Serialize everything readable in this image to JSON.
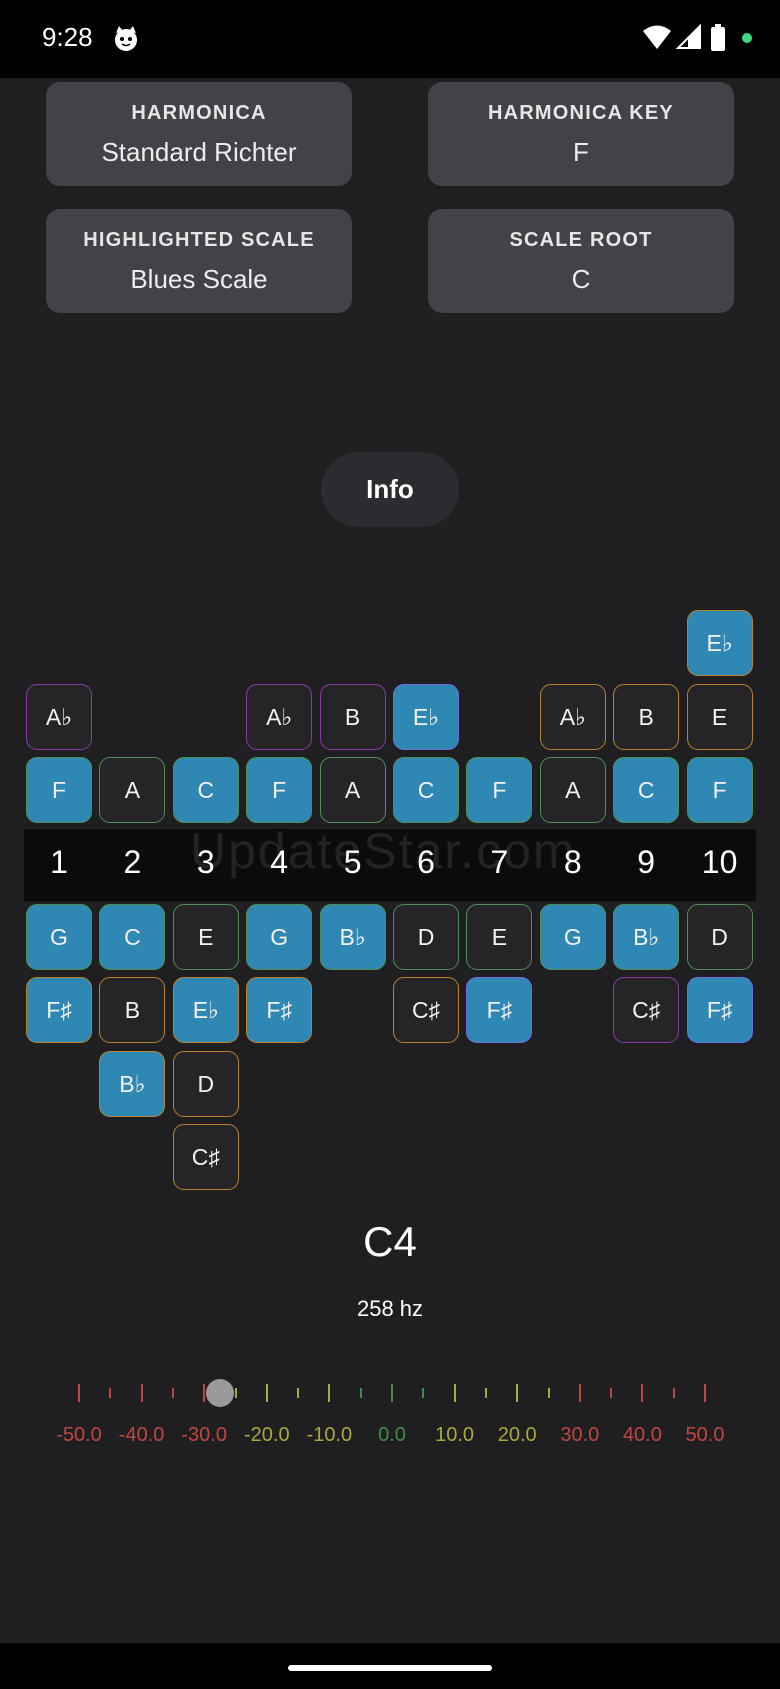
{
  "status": {
    "time": "9:28"
  },
  "cards": {
    "harmonica": {
      "label": "HARMONICA",
      "value": "Standard Richter"
    },
    "harmonica_key": {
      "label": "HARMONICA KEY",
      "value": "F"
    },
    "highlighted_scale": {
      "label": "HIGHLIGHTED SCALE",
      "value": "Blues Scale"
    },
    "scale_root": {
      "label": "SCALE ROOT",
      "value": "C"
    }
  },
  "info_button": "Info",
  "colors": {
    "highlight": "#2e88b3",
    "green_border": "#4f8f55",
    "purple_border": "#8a3aa8",
    "orange_border": "#b7822a",
    "blue_border": "#6f6fe0",
    "red_tick": "#c0463f",
    "yellow_tick": "#a9a83a",
    "green_tick": "#3e8f45"
  },
  "holes": [
    "1",
    "2",
    "3",
    "4",
    "5",
    "6",
    "7",
    "8",
    "9",
    "10"
  ],
  "note_grid": [
    {
      "note": "E♭",
      "hole": 10,
      "row": -3,
      "highlighted": true,
      "border": "orange"
    },
    {
      "note": "A♭",
      "hole": 1,
      "row": -2,
      "highlighted": false,
      "border": "purple"
    },
    {
      "note": "A♭",
      "hole": 4,
      "row": -2,
      "highlighted": false,
      "border": "purple"
    },
    {
      "note": "B",
      "hole": 5,
      "row": -2,
      "highlighted": false,
      "border": "purple"
    },
    {
      "note": "E♭",
      "hole": 6,
      "row": -2,
      "highlighted": true,
      "border": "blue"
    },
    {
      "note": "A♭",
      "hole": 8,
      "row": -2,
      "highlighted": false,
      "border": "orange"
    },
    {
      "note": "B",
      "hole": 9,
      "row": -2,
      "highlighted": false,
      "border": "orange"
    },
    {
      "note": "E",
      "hole": 10,
      "row": -2,
      "highlighted": false,
      "border": "orange"
    },
    {
      "note": "F",
      "hole": 1,
      "row": -1,
      "highlighted": true,
      "border": "green"
    },
    {
      "note": "A",
      "hole": 2,
      "row": -1,
      "highlighted": false,
      "border": "green"
    },
    {
      "note": "C",
      "hole": 3,
      "row": -1,
      "highlighted": true,
      "border": "green"
    },
    {
      "note": "F",
      "hole": 4,
      "row": -1,
      "highlighted": true,
      "border": "green"
    },
    {
      "note": "A",
      "hole": 5,
      "row": -1,
      "highlighted": false,
      "border": "green"
    },
    {
      "note": "C",
      "hole": 6,
      "row": -1,
      "highlighted": true,
      "border": "green"
    },
    {
      "note": "F",
      "hole": 7,
      "row": -1,
      "highlighted": true,
      "border": "green"
    },
    {
      "note": "A",
      "hole": 8,
      "row": -1,
      "highlighted": false,
      "border": "green"
    },
    {
      "note": "C",
      "hole": 9,
      "row": -1,
      "highlighted": true,
      "border": "green"
    },
    {
      "note": "F",
      "hole": 10,
      "row": -1,
      "highlighted": true,
      "border": "green"
    },
    {
      "note": "G",
      "hole": 1,
      "row": 1,
      "highlighted": true,
      "border": "green"
    },
    {
      "note": "C",
      "hole": 2,
      "row": 1,
      "highlighted": true,
      "border": "green"
    },
    {
      "note": "E",
      "hole": 3,
      "row": 1,
      "highlighted": false,
      "border": "green"
    },
    {
      "note": "G",
      "hole": 4,
      "row": 1,
      "highlighted": true,
      "border": "green"
    },
    {
      "note": "B♭",
      "hole": 5,
      "row": 1,
      "highlighted": true,
      "border": "green"
    },
    {
      "note": "D",
      "hole": 6,
      "row": 1,
      "highlighted": false,
      "border": "green"
    },
    {
      "note": "E",
      "hole": 7,
      "row": 1,
      "highlighted": false,
      "border": "green"
    },
    {
      "note": "G",
      "hole": 8,
      "row": 1,
      "highlighted": true,
      "border": "green"
    },
    {
      "note": "B♭",
      "hole": 9,
      "row": 1,
      "highlighted": true,
      "border": "green"
    },
    {
      "note": "D",
      "hole": 10,
      "row": 1,
      "highlighted": false,
      "border": "green"
    },
    {
      "note": "F♯",
      "hole": 1,
      "row": 2,
      "highlighted": true,
      "border": "orange"
    },
    {
      "note": "B",
      "hole": 2,
      "row": 2,
      "highlighted": false,
      "border": "orange"
    },
    {
      "note": "E♭",
      "hole": 3,
      "row": 2,
      "highlighted": true,
      "border": "orange"
    },
    {
      "note": "F♯",
      "hole": 4,
      "row": 2,
      "highlighted": true,
      "border": "orange"
    },
    {
      "note": "C♯",
      "hole": 6,
      "row": 2,
      "highlighted": false,
      "border": "orange"
    },
    {
      "note": "F♯",
      "hole": 7,
      "row": 2,
      "highlighted": true,
      "border": "blue"
    },
    {
      "note": "C♯",
      "hole": 9,
      "row": 2,
      "highlighted": false,
      "border": "purple"
    },
    {
      "note": "F♯",
      "hole": 10,
      "row": 2,
      "highlighted": true,
      "border": "blue"
    },
    {
      "note": "B♭",
      "hole": 2,
      "row": 3,
      "highlighted": true,
      "border": "orange"
    },
    {
      "note": "D",
      "hole": 3,
      "row": 3,
      "highlighted": false,
      "border": "orange"
    },
    {
      "note": "C♯",
      "hole": 3,
      "row": 4,
      "highlighted": false,
      "border": "orange"
    }
  ],
  "tuner": {
    "note": "C4",
    "frequency": "258 hz",
    "cents_offset": -27.5,
    "scale_labels": [
      "-50.0",
      "-40.0",
      "-30.0",
      "-20.0",
      "-10.0",
      "0.0",
      "10.0",
      "20.0",
      "30.0",
      "40.0",
      "50.0"
    ]
  },
  "watermark": "UpdateStar.com"
}
